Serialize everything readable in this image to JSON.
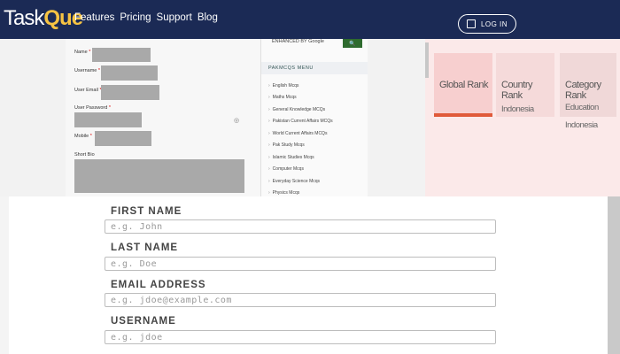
{
  "header": {
    "logo_prefix": "Task",
    "logo_accent": "Que",
    "nav": [
      "Features",
      "Pricing",
      "Support",
      "Blog"
    ],
    "login_label": "LOG IN"
  },
  "top_form": {
    "labels": [
      "Name",
      "Username",
      "User Email",
      "User Password",
      "Mobile",
      "Short Bio"
    ]
  },
  "sidebar": {
    "search_text": "ENHANCED BY Google",
    "search_button": "🔍",
    "menu_title": "PAKMCQS MENU",
    "menu_items": [
      "English Mcqs",
      "Maths Mcqs",
      "General Knowledge MCQs",
      "Pakistan Current Affairs MCQs",
      "World Current Affairs MCQs",
      "Pak Study Mcqs",
      "Islamic Studies Mcqs",
      "Computer Mcqs",
      "Everyday Science Mcqs",
      "Physics Mcqs"
    ]
  },
  "ranks": {
    "global_title": "Global Rank",
    "country_title": "Country Rank",
    "country_value": "Indonesia",
    "category_title": "Category Rank",
    "category_value1": "Education",
    "category_value2": "Indonesia"
  },
  "signup_form": {
    "fields": [
      {
        "label": "FIRST NAME",
        "placeholder": "e.g. John"
      },
      {
        "label": "LAST NAME",
        "placeholder": "e.g. Doe"
      },
      {
        "label": "EMAIL ADDRESS",
        "placeholder": "e.g. jdoe@example.com"
      },
      {
        "label": "USERNAME",
        "placeholder": "e.g. jdoe"
      }
    ]
  },
  "colors": {
    "header_bg": "#1b2a55",
    "logo_accent": "#f6c343",
    "accent_bar": "#e05a3a"
  }
}
